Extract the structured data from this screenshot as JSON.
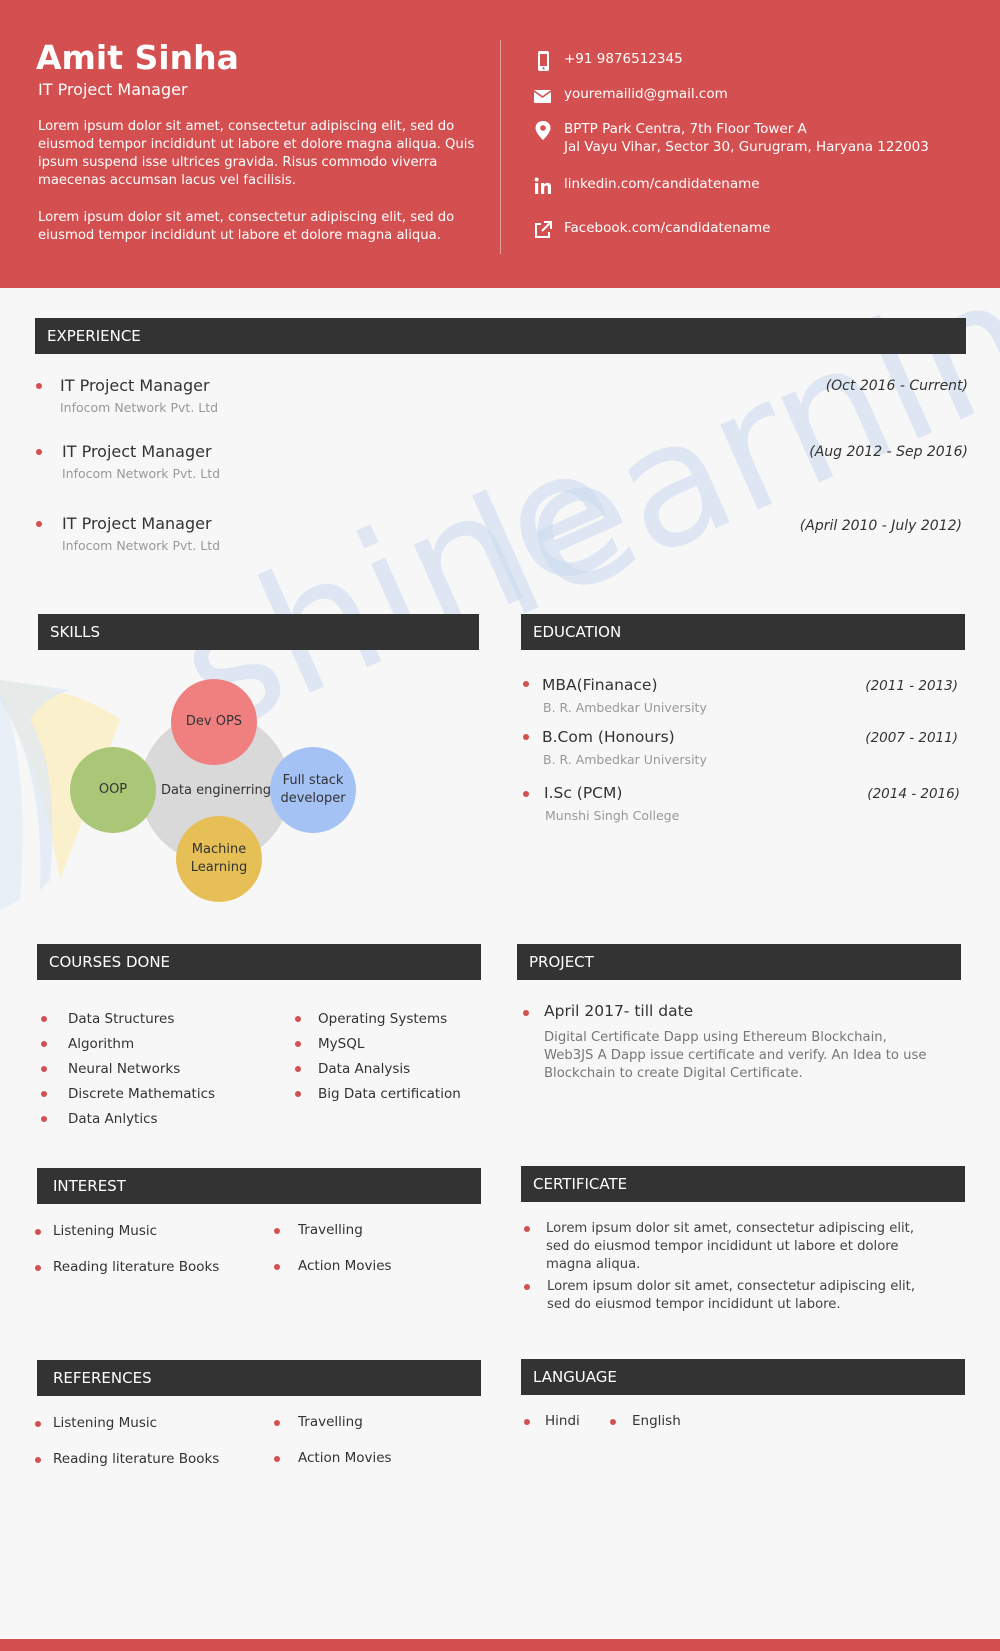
{
  "header": {
    "name": "Amit Sinha",
    "title": "IT Project Manager",
    "summary": [
      "Lorem ipsum dolor sit amet, consectetur adipiscing elit, sed do eiusmod tempor incididunt ut labore et dolore magna aliqua. Quis ipsum suspend isse ultrices gravida. Risus commodo viverra maecenas accumsan lacus vel facilisis.",
      "Lorem ipsum dolor sit amet, consectetur adipiscing elit, sed do eiusmod tempor incididunt ut labore et dolore magna aliqua."
    ],
    "contacts": [
      {
        "icon": "phone-icon",
        "text": "+91 9876512345"
      },
      {
        "icon": "email-icon",
        "text": "youremailid@gmail.com"
      },
      {
        "icon": "location-icon",
        "line1": "BPTP Park Centra, 7th Floor Tower A",
        "line2": "Jal Vayu Vihar, Sector 30, Gurugram, Haryana 122003"
      },
      {
        "icon": "linkedin-icon",
        "text": "linkedin.com/candidatename"
      },
      {
        "icon": "external-link-icon",
        "text": "Facebook.com/candidatename"
      }
    ]
  },
  "sections": {
    "experience": "EXPERIENCE",
    "skills": "SKILLS",
    "education": "EDUCATION",
    "courses": "COURSES DONE",
    "project": "PROJECT",
    "interest": "INTEREST",
    "certificate": "CERTIFICATE",
    "references": "REFERENCES",
    "language": "LANGUAGE"
  },
  "experience": [
    {
      "role": "IT Project Manager",
      "org": "Infocom Network Pvt. Ltd",
      "date": "(Oct 2016 - Current)"
    },
    {
      "role": "IT Project Manager",
      "org": "Infocom Network Pvt. Ltd",
      "date": "(Aug 2012 - Sep 2016)"
    },
    {
      "role": "IT Project Manager",
      "org": "Infocom Network Pvt. Ltd",
      "date": "(April 2010 - July 2012)"
    }
  ],
  "skills": {
    "center": "Data enginerring",
    "items": [
      "Dev OPS",
      "Full stack developer",
      "Machine Learning",
      "OOP"
    ],
    "colors": {
      "devops": "#f08080",
      "fullstack": "#a4c2f4",
      "ml": "#e6c057",
      "oop": "#a9c777",
      "center": "#d9d9d9"
    }
  },
  "education": [
    {
      "degree": "MBA(Finanace)",
      "institution": "B. R. Ambedkar University",
      "date": "(2011 - 2013)"
    },
    {
      "degree": "B.Com (Honours)",
      "institution": "B. R. Ambedkar University",
      "date": "(2007 - 2011)"
    },
    {
      "degree": "I.Sc (PCM)",
      "institution": "Munshi Singh College",
      "date": "(2014 - 2016)"
    }
  ],
  "courses": {
    "left": [
      "Data Structures",
      "Algorithm",
      "Neural Networks",
      "Discrete Mathematics",
      "Data Anlytics"
    ],
    "right": [
      "Operating Systems",
      "MySQL",
      "Data Analysis",
      "Big Data certification"
    ]
  },
  "project": {
    "title": "April 2017- till date",
    "description": "Digital Certificate Dapp using Ethereum Blockchain, Web3JS A Dapp issue certificate and verify. An Idea to use Blockchain to create Digital Certificate."
  },
  "interest": {
    "left": [
      "Listening Music",
      "Reading literature Books"
    ],
    "right": [
      "Travelling",
      "Action Movies"
    ]
  },
  "certificate": [
    "Lorem ipsum dolor sit amet, consectetur adipiscing elit, sed do eiusmod tempor incididunt ut labore et dolore magna aliqua.",
    "Lorem ipsum dolor sit amet, consectetur adipiscing elit, sed do eiusmod tempor incididunt ut labore."
  ],
  "references": {
    "left": [
      "Listening Music",
      "Reading literature Books"
    ],
    "right": [
      "Travelling",
      "Action Movies"
    ]
  },
  "language": [
    "Hindi",
    "English"
  ],
  "watermark": "shine learning",
  "colors": {
    "accent": "#d44f4f",
    "bar": "#333333",
    "muted": "#999999"
  }
}
